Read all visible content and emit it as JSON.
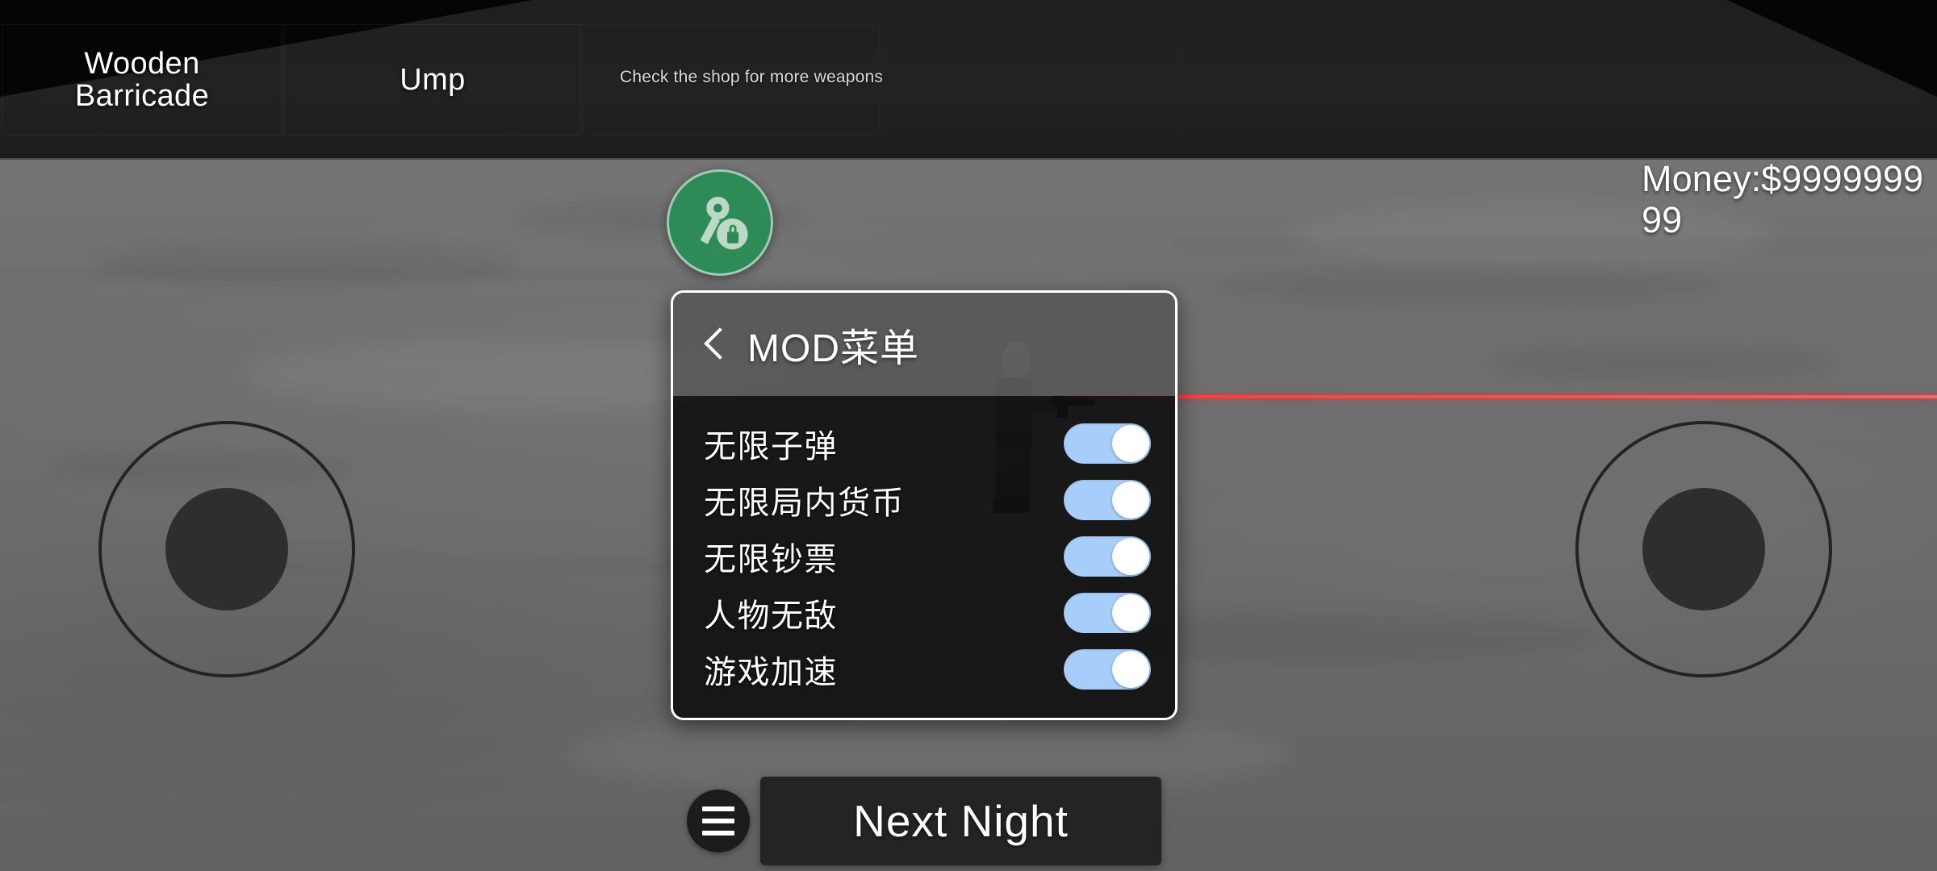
{
  "hud": {
    "inventory_slots": [
      {
        "label": "Wooden\nBarricade",
        "label_line1": "Wooden",
        "label_line2": "Barricade"
      },
      {
        "label": "Ump",
        "label_line1": "Ump",
        "label_line2": ""
      },
      {
        "label": "",
        "label_line1": "",
        "label_line2": ""
      },
      {
        "label": "",
        "label_line1": "",
        "label_line2": ""
      }
    ],
    "shop_hint": "Check the shop for more weapons",
    "money_label": "Money:$999999999"
  },
  "mod_launcher": {
    "icon": "key-lock-icon",
    "color": "#2e8b57"
  },
  "mod_panel": {
    "title": "MOD菜单",
    "back_icon": "chevron-left-icon",
    "accent_on_color": "#a7cdfa",
    "rows": [
      {
        "label": "无限子弹",
        "state": "on"
      },
      {
        "label": "无限局内货币",
        "state": "on"
      },
      {
        "label": "无限钞票",
        "state": "on"
      },
      {
        "label": "人物无敌",
        "state": "on"
      },
      {
        "label": "游戏加速",
        "state": "on"
      }
    ]
  },
  "controls": {
    "left_joystick": "movement-joystick",
    "right_joystick": "aim-joystick",
    "menu_button_icon": "hamburger-icon",
    "next_night_label": "Next Night"
  }
}
